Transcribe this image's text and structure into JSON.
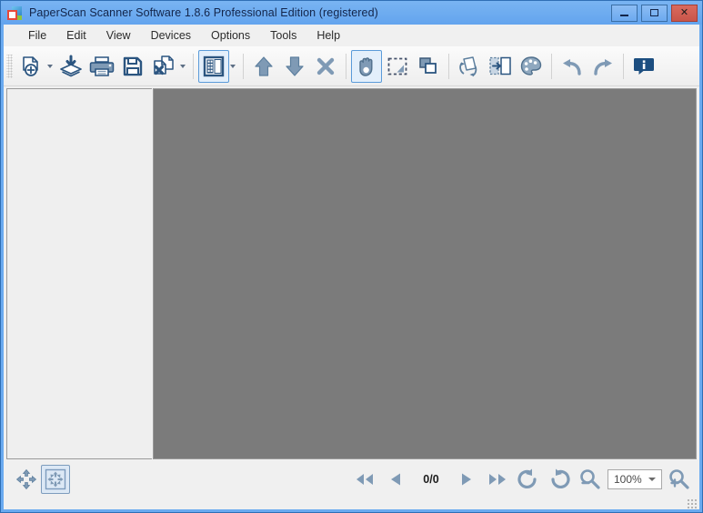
{
  "window": {
    "title": "PaperScan Scanner Software 1.8.6 Professional Edition (registered)",
    "app_icon": "paperscan-logo-icon",
    "controls": {
      "minimize": "minimize-button",
      "maximize": "maximize-button",
      "close_label": "✕"
    },
    "colors": {
      "titlebar": "#6aaaf0",
      "frame": "#2f6fb5",
      "close_button": "#c9554a",
      "canvas": "#7b7b7b",
      "chrome": "#f0f0f0",
      "accent_selected": "#5b9bd9",
      "icon_blue": "#7f9ab5",
      "icon_dark_blue": "#2b5580"
    }
  },
  "menubar": {
    "items": [
      {
        "label": "File"
      },
      {
        "label": "Edit"
      },
      {
        "label": "View"
      },
      {
        "label": "Devices"
      },
      {
        "label": "Options"
      },
      {
        "label": "Tools"
      },
      {
        "label": "Help"
      }
    ]
  },
  "toolbar": {
    "groups": [
      {
        "buttons": [
          {
            "name": "new-document-button",
            "icon": "document-add-icon",
            "has_dropdown": true
          },
          {
            "name": "import-pages-button",
            "icon": "import-stack-icon",
            "has_dropdown": false
          },
          {
            "name": "print-button",
            "icon": "printer-icon",
            "has_dropdown": false
          },
          {
            "name": "save-button",
            "icon": "floppy-save-icon",
            "has_dropdown": false
          },
          {
            "name": "delete-page-button",
            "icon": "document-delete-icon",
            "has_dropdown": true
          }
        ]
      },
      {
        "buttons": [
          {
            "name": "thumbnail-panel-button",
            "icon": "panel-layout-icon",
            "has_dropdown": true,
            "active": true
          }
        ]
      },
      {
        "buttons": [
          {
            "name": "move-page-up-button",
            "icon": "arrow-up-icon",
            "has_dropdown": false
          },
          {
            "name": "move-page-down-button",
            "icon": "arrow-down-icon",
            "has_dropdown": false
          },
          {
            "name": "remove-page-button",
            "icon": "close-x-icon",
            "has_dropdown": false
          }
        ]
      },
      {
        "buttons": [
          {
            "name": "hand-tool-button",
            "icon": "hand-icon",
            "has_dropdown": false,
            "active": true
          },
          {
            "name": "select-region-button",
            "icon": "dashed-selection-icon",
            "has_dropdown": false
          },
          {
            "name": "crop-button",
            "icon": "crop-icon",
            "has_dropdown": false
          }
        ]
      },
      {
        "buttons": [
          {
            "name": "deskew-button",
            "icon": "deskew-page-icon",
            "has_dropdown": false
          },
          {
            "name": "split-page-button",
            "icon": "split-page-icon",
            "has_dropdown": false
          },
          {
            "name": "color-adjust-button",
            "icon": "color-palette-icon",
            "has_dropdown": false
          }
        ]
      },
      {
        "buttons": [
          {
            "name": "undo-button",
            "icon": "undo-arrow-icon",
            "has_dropdown": false
          },
          {
            "name": "redo-button",
            "icon": "redo-arrow-icon",
            "has_dropdown": false
          }
        ]
      },
      {
        "buttons": [
          {
            "name": "info-button",
            "icon": "info-bubble-icon",
            "has_dropdown": false
          }
        ]
      }
    ]
  },
  "sidebar": {
    "name": "thumbnail-panel",
    "items": []
  },
  "canvas": {
    "name": "page-viewer",
    "content": ""
  },
  "bottombar": {
    "fit_buttons": [
      {
        "name": "fit-to-window-button",
        "icon": "move-arrows-icon",
        "active": false
      },
      {
        "name": "fit-page-button",
        "icon": "fit-page-icon",
        "active": true
      }
    ],
    "navigation": [
      {
        "name": "first-page-button",
        "icon": "skip-backward-icon"
      },
      {
        "name": "previous-page-button",
        "icon": "play-backward-icon"
      }
    ],
    "page_counter": "0/0",
    "navigation_after": [
      {
        "name": "next-page-button",
        "icon": "play-forward-icon"
      },
      {
        "name": "last-page-button",
        "icon": "skip-forward-icon"
      },
      {
        "name": "rotate-left-button",
        "icon": "rotate-ccw-icon"
      },
      {
        "name": "rotate-right-button",
        "icon": "rotate-cw-icon"
      }
    ],
    "zoom": {
      "out_button": "zoom-out-icon",
      "value": "100%",
      "in_button": "zoom-in-icon"
    }
  }
}
